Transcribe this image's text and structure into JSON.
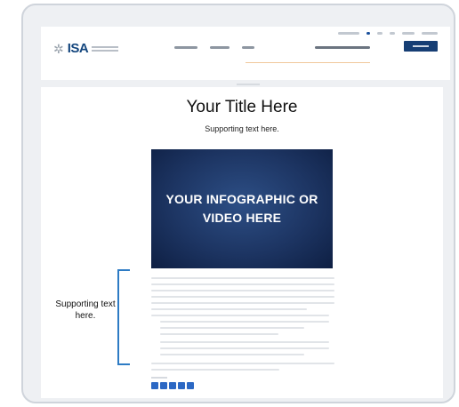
{
  "header": {
    "logo_text": "ISA"
  },
  "content": {
    "title": "Your Title Here",
    "subtitle": "Supporting text here.",
    "media_placeholder": "YOUR INFOGRAPHIC OR VIDEO HERE"
  },
  "annotation": {
    "text": "Supporting text here."
  },
  "colors": {
    "accent": "#2d7bc4",
    "brand": "#14467e",
    "media_bg": "#1d3563"
  },
  "icons": {
    "logo_glyph": "flower-icon",
    "share": [
      "twitter-icon",
      "linkedin-icon",
      "facebook-icon",
      "share-icon",
      "email-icon"
    ]
  }
}
